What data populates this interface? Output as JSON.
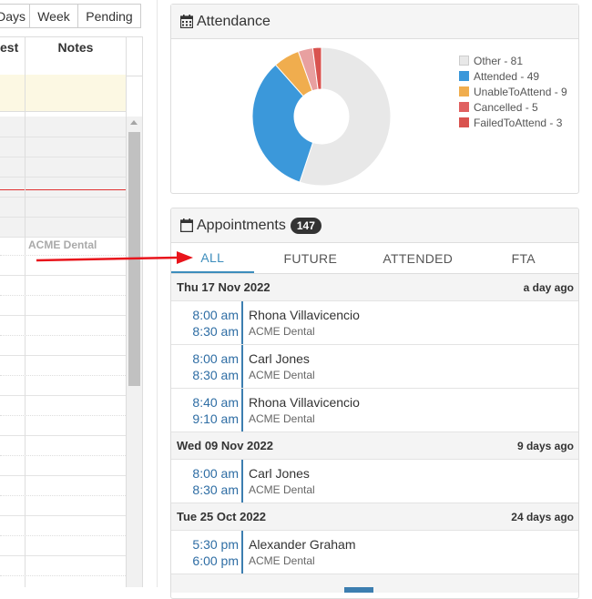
{
  "calendar": {
    "view_buttons": [
      "Days",
      "Week",
      "Pending"
    ],
    "columns": [
      "est",
      "Notes"
    ],
    "cell_clinic": "ACME Dental"
  },
  "attendance": {
    "title": "Attendance",
    "icon": "calendar-grid-icon",
    "chart_data": {
      "type": "pie",
      "labels": [
        "Other",
        "Attended",
        "UnableToAttend",
        "Cancelled",
        "FailedToAttend"
      ],
      "values": [
        81,
        49,
        9,
        5,
        3
      ],
      "colors": [
        "#e8e8e8",
        "#3b98da",
        "#f0ad4e",
        "#e8a0a0",
        "#d9534f"
      ],
      "legend_labels": [
        "Other - 81",
        "Attended - 49",
        "UnableToAttend - 9",
        "Cancelled - 5",
        "FailedToAttend - 3"
      ],
      "legend_position": "right",
      "donut": true
    }
  },
  "appointments": {
    "title": "Appointments",
    "icon": "calendar-icon",
    "count": "147",
    "tabs": [
      "ALL",
      "FUTURE",
      "ATTENDED",
      "FTA"
    ],
    "active_tab": "ALL",
    "groups": [
      {
        "date": "Thu 17 Nov 2022",
        "ago": "a day ago",
        "items": [
          {
            "start": "8:00 am",
            "end": "8:30 am",
            "name": "Rhona Villavicencio",
            "clinic": "ACME Dental"
          },
          {
            "start": "8:00 am",
            "end": "8:30 am",
            "name": "Carl Jones",
            "clinic": "ACME Dental"
          },
          {
            "start": "8:40 am",
            "end": "9:10 am",
            "name": "Rhona Villavicencio",
            "clinic": "ACME Dental"
          }
        ]
      },
      {
        "date": "Wed 09 Nov 2022",
        "ago": "9 days ago",
        "items": [
          {
            "start": "8:00 am",
            "end": "8:30 am",
            "name": "Carl Jones",
            "clinic": "ACME Dental"
          }
        ]
      },
      {
        "date": "Tue 25 Oct 2022",
        "ago": "24 days ago",
        "items": [
          {
            "start": "5:30 pm",
            "end": "6:00 pm",
            "name": "Alexander Graham",
            "clinic": "ACME Dental"
          }
        ]
      }
    ]
  },
  "annotation": {
    "arrow_color": "#e8141b"
  }
}
